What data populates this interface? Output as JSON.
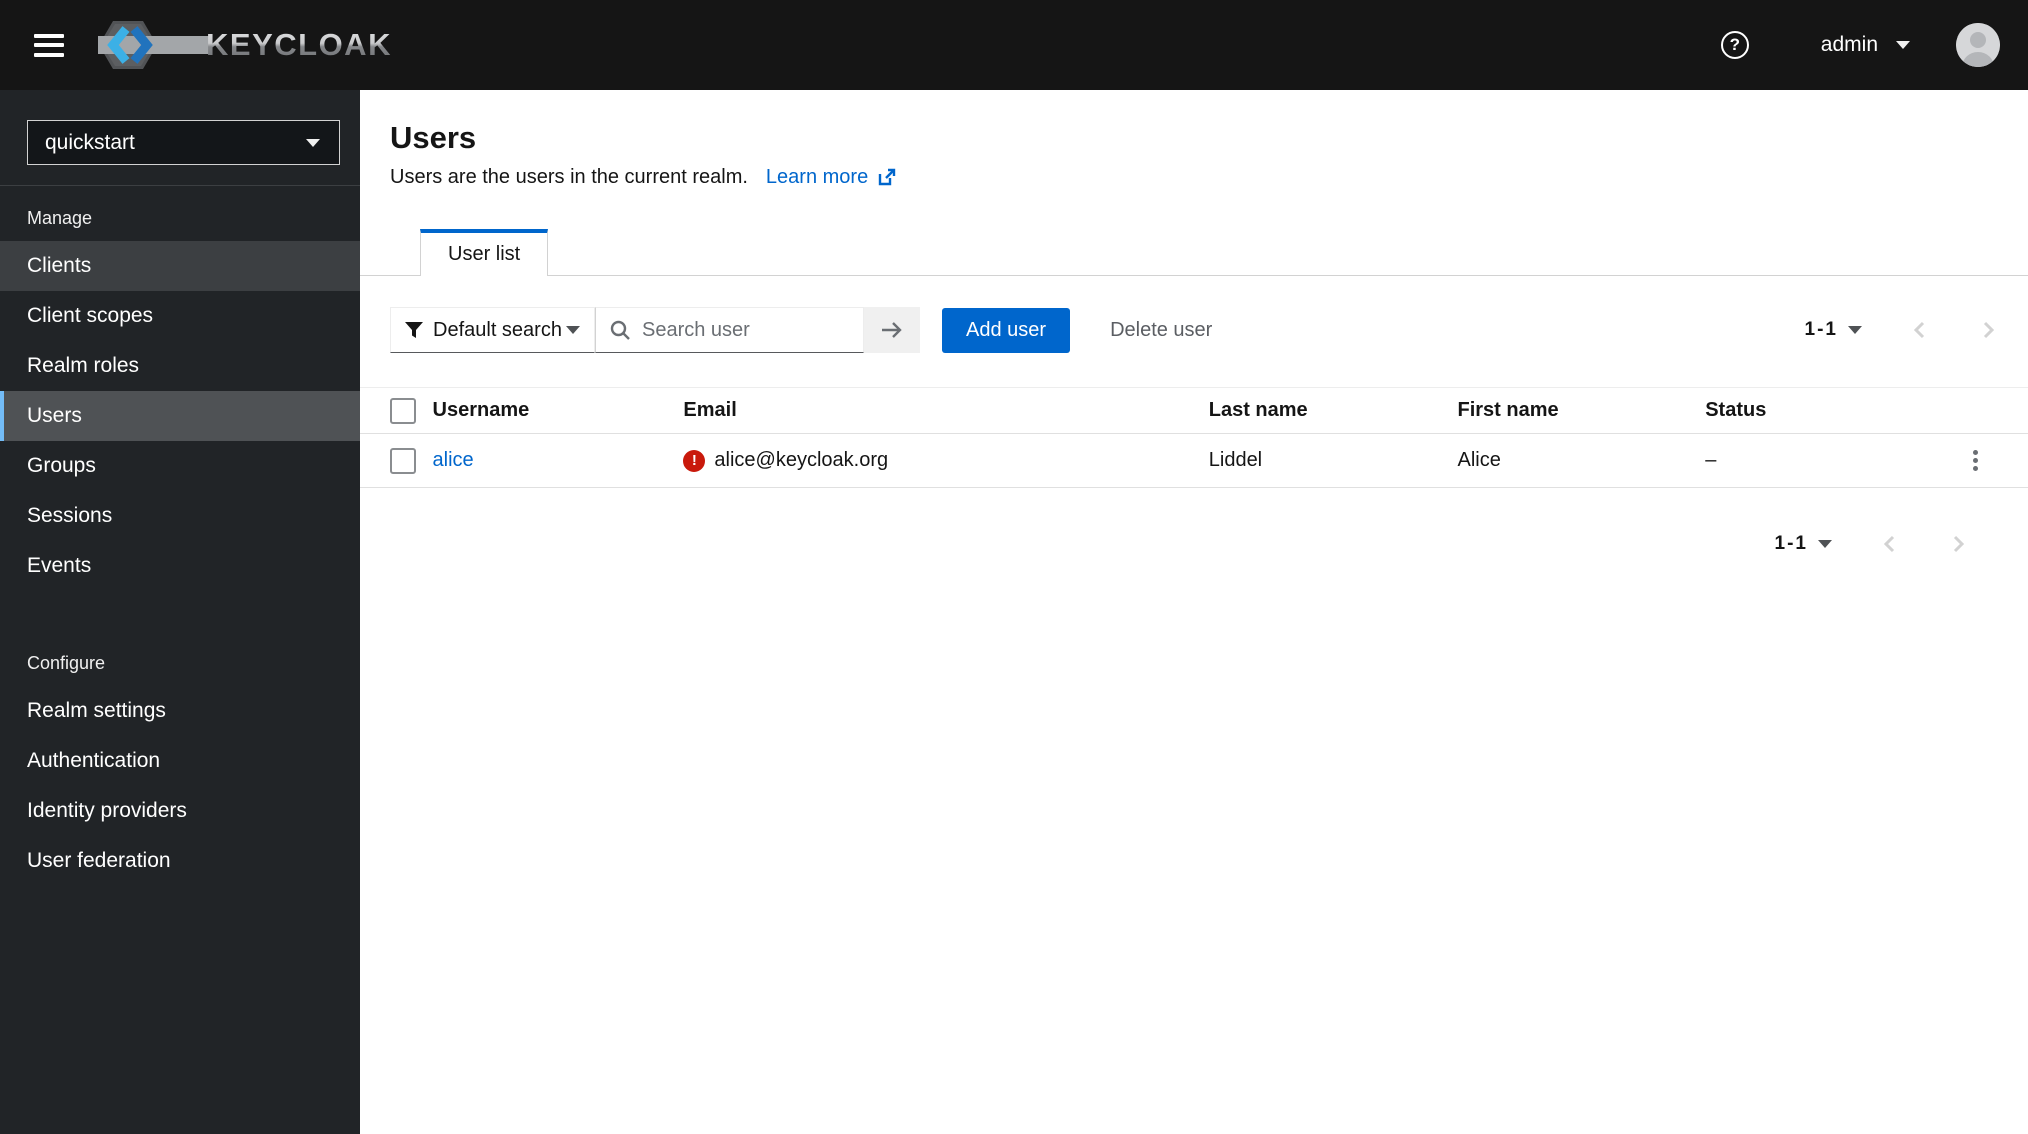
{
  "masthead": {
    "brand": "KEYCLOAK",
    "help_icon_glyph": "?",
    "user": "admin"
  },
  "sidebar": {
    "realm": "quickstart",
    "sections": [
      {
        "title": "Manage",
        "items": [
          {
            "label": "Clients"
          },
          {
            "label": "Client scopes"
          },
          {
            "label": "Realm roles"
          },
          {
            "label": "Users"
          },
          {
            "label": "Groups"
          },
          {
            "label": "Sessions"
          },
          {
            "label": "Events"
          }
        ]
      },
      {
        "title": "Configure",
        "items": [
          {
            "label": "Realm settings"
          },
          {
            "label": "Authentication"
          },
          {
            "label": "Identity providers"
          },
          {
            "label": "User federation"
          }
        ]
      }
    ]
  },
  "page": {
    "title": "Users",
    "description": "Users are the users in the current realm.",
    "learn_more_label": "Learn more",
    "tab_label": "User list"
  },
  "toolbar": {
    "filter_label": "Default search",
    "search_placeholder": "Search user",
    "add_user_label": "Add user",
    "delete_user_label": "Delete user",
    "pagination": "1-1"
  },
  "table": {
    "headers": {
      "username": "Username",
      "email": "Email",
      "last_name": "Last name",
      "first_name": "First name",
      "status": "Status"
    },
    "rows": [
      {
        "username": "alice",
        "email": "alice@keycloak.org",
        "last_name": "Liddel",
        "first_name": "Alice",
        "status": "–"
      }
    ]
  },
  "footer": {
    "pagination": "1-1"
  },
  "colors": {
    "accent": "#0066cc",
    "danger": "#c9190b",
    "masthead_bg": "#151515",
    "sidebar_bg": "#212427",
    "selected_border": "#73bcf7"
  }
}
